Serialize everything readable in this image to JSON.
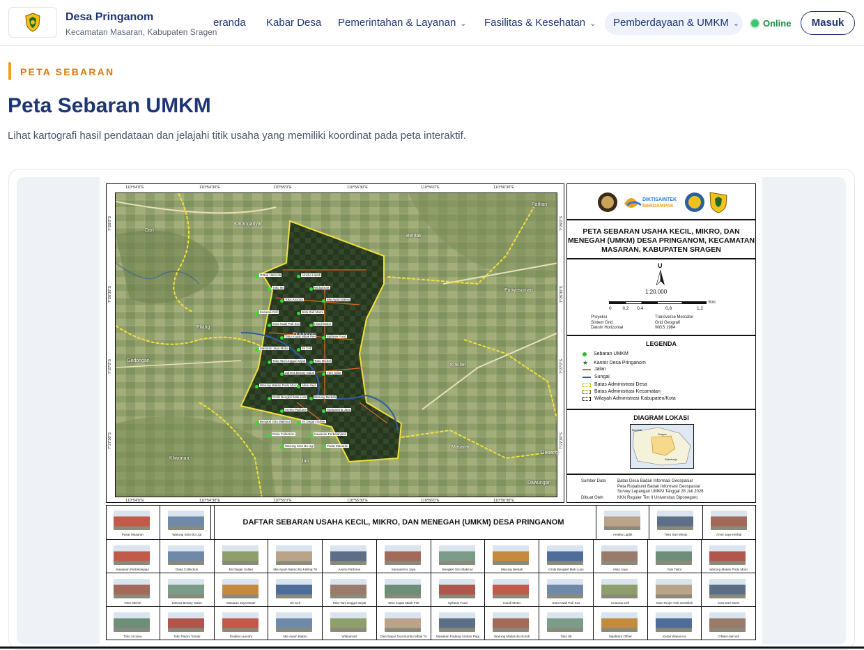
{
  "header": {
    "brand_title": "Desa Pringanom",
    "brand_sub": "Kecamatan Masaran, Kabupaten Sragen",
    "nav": [
      {
        "label": "eranda",
        "dropdown": false
      },
      {
        "label": "Kabar Desa",
        "dropdown": false
      },
      {
        "label": "Pemerintahan & Layanan",
        "dropdown": true
      },
      {
        "label": "Fasilitas & Kesehatan",
        "dropdown": true
      },
      {
        "label": "Pemberdayaan & UMKM",
        "dropdown": true,
        "active": true
      }
    ],
    "status": "Online",
    "login_label": "Masuk"
  },
  "page": {
    "eyebrow": "PETA SEBARAN",
    "title": "Peta Sebaran UMKM",
    "lead": "Lihat kartografi hasil pendataan dan jelajahi titik usaha yang memiliki koordinat pada peta interaktif."
  },
  "map": {
    "title": "PETA SEBARAN USAHA KECIL, MIKRO, DAN MENEGAH (UMKM) DESA PRINGANOM, KECAMATAN MASARAN, KABUPATEN SRAGEN",
    "logos": [
      "DIKTISAINTEK BERDAMPAK"
    ],
    "north": "U",
    "scale": "1:20.000",
    "scale_ticks": [
      "0",
      "0,2",
      "0,4",
      "0,8",
      "1,2"
    ],
    "scale_unit": "Km",
    "projection": [
      {
        "k": "Proyeksi",
        "v": "Transverse Mercator"
      },
      {
        "k": "Sistem Grid",
        "v": "Grid Geografi"
      },
      {
        "k": "Datum Horizontal",
        "v": "WGS 1984"
      }
    ],
    "legend_title": "LEGENDA",
    "legend": [
      "Sebaran UMKM",
      "Kantor Desa Pringanom",
      "Jalan",
      "Sungai",
      "Batas Administrasi Desa",
      "Batas Administrasi Kecamatan",
      "Wilayah Administrasi Kabupaten/Kota"
    ],
    "inset_title": "DIAGRAM LOKASI",
    "inset_labels": [
      "Sragen",
      "Boyolali",
      "Sukoharjo",
      "Karanganyar",
      "Kota Surakarta",
      "Ngawi",
      "Grobogan",
      "Magetan"
    ],
    "source_label": "Sumber Data",
    "source": [
      "Batas Desa Badan Informasi Geospasial",
      "Peta Rupabumi Badan Informasi Geospasial",
      "Survey Lapangan UMKM Tanggal 28 Juli 2026"
    ],
    "made_by_label": "Dibuat Oleh",
    "made_by": "KKN Reguler Tim II Universitas Diponegoro",
    "top_coords": [
      "110°54'0\"E",
      "110°54'30\"E",
      "110°55'0\"E",
      "110°55'30\"E",
      "110°56'0\"E",
      "110°56'30\"E"
    ],
    "side_coords": [
      "7°26'0\"S",
      "7°26'30\"S",
      "7°27'0\"S",
      "7°27'30\"S"
    ],
    "places": [
      "Dari",
      "Karanganyar",
      "Bentak",
      "Pathan",
      "Purwosuman",
      "Pilang",
      "Pringanom",
      "Gedongan",
      "Krikilan",
      "Kliwonan",
      "Jati",
      "Masaran",
      "Gebang",
      "Dawungan"
    ],
    "umkm_labels": [
      "O'Bae Haircuts",
      "Amelia Laptik",
      "Toko 98",
      "Widyamart",
      "Toko Arciona",
      "Mie Ayam Bakso",
      "Kusuma Cell",
      "Soto Sari Mumi",
      "Soto Kwali Pak Sus",
      "Handi Motor",
      "Tahu Kupat Mbak Piet",
      "Syifanie Food",
      "Masaran Jaya Motor",
      "Eli Cell",
      "Toko Tani Unggul Sejati",
      "Toko Michel",
      "Zahera Beauty Salon",
      "Yani Tailor",
      "Warung Makan Podo Moro",
      "Alina Jaya",
      "Grobi Bengkel Mak Lumi",
      "Warung Berkah",
      "Arvino Parfume",
      "Sampoerna Jaya",
      "Bengkel Gito Makmur",
      "Es Degan Suliter",
      "Deka Collection",
      "Kawasan Perbelanjaan",
      "Warung Soto Bu Ugi",
      "Pasar Masaran"
    ]
  },
  "gallery": {
    "title": "DAFTAR SEBARAN USAHA KECIL, MIKRO, DAN MENEGAH (UMKM) DESA PRINGANOM",
    "row1_left": [
      "Pasar Masaran",
      "Warung Soto Bu Ugi"
    ],
    "row1_right": [
      "Amelia Laptik",
      "Toko Sari Mirojo",
      "Amel Jaya Herbal"
    ],
    "row2": [
      "Kawasan Perbelanjaan",
      "Deka Collection",
      "Es Degan Suliter",
      "Mie Ayam Bakso Bu Kelling 79",
      "Arvino Parfume",
      "Sampoerna Jaya",
      "Bengkel Gito Makmur",
      "Warung Berkah",
      "Grobi Bengkel Mak Lumi",
      "Alina Jaya",
      "Yani Tailor",
      "Warung Makan Podo Moro"
    ],
    "row3": [
      "Toko Michel",
      "Zahera Beauty Salon",
      "Masaran Jaya Motor",
      "Eli Cell",
      "Toko Tani Unggul Sejati",
      "Tahu Kupat Mbak Piet",
      "Syifanie Food",
      "Handi Motor",
      "Soto Kwali Pak Sus",
      "Kusuma Cell",
      "Soto Tunjer Pak Gembloh",
      "Soto Sari Mumi"
    ],
    "row4": [
      "Toko Arciona",
      "Toko Paloni Tomati",
      "Realita Laundry",
      "Mie Ayam Bakso",
      "Widyamart",
      "Dain Bayar Dua Bumbu Mbak Tri",
      "Masakan Padang Amban Pagi",
      "Warung Makan Bu Kondi",
      "Toko 98",
      "Sejahtera Offset",
      "Kedai Wasai Ina",
      "O'Bae Haircuts"
    ]
  }
}
